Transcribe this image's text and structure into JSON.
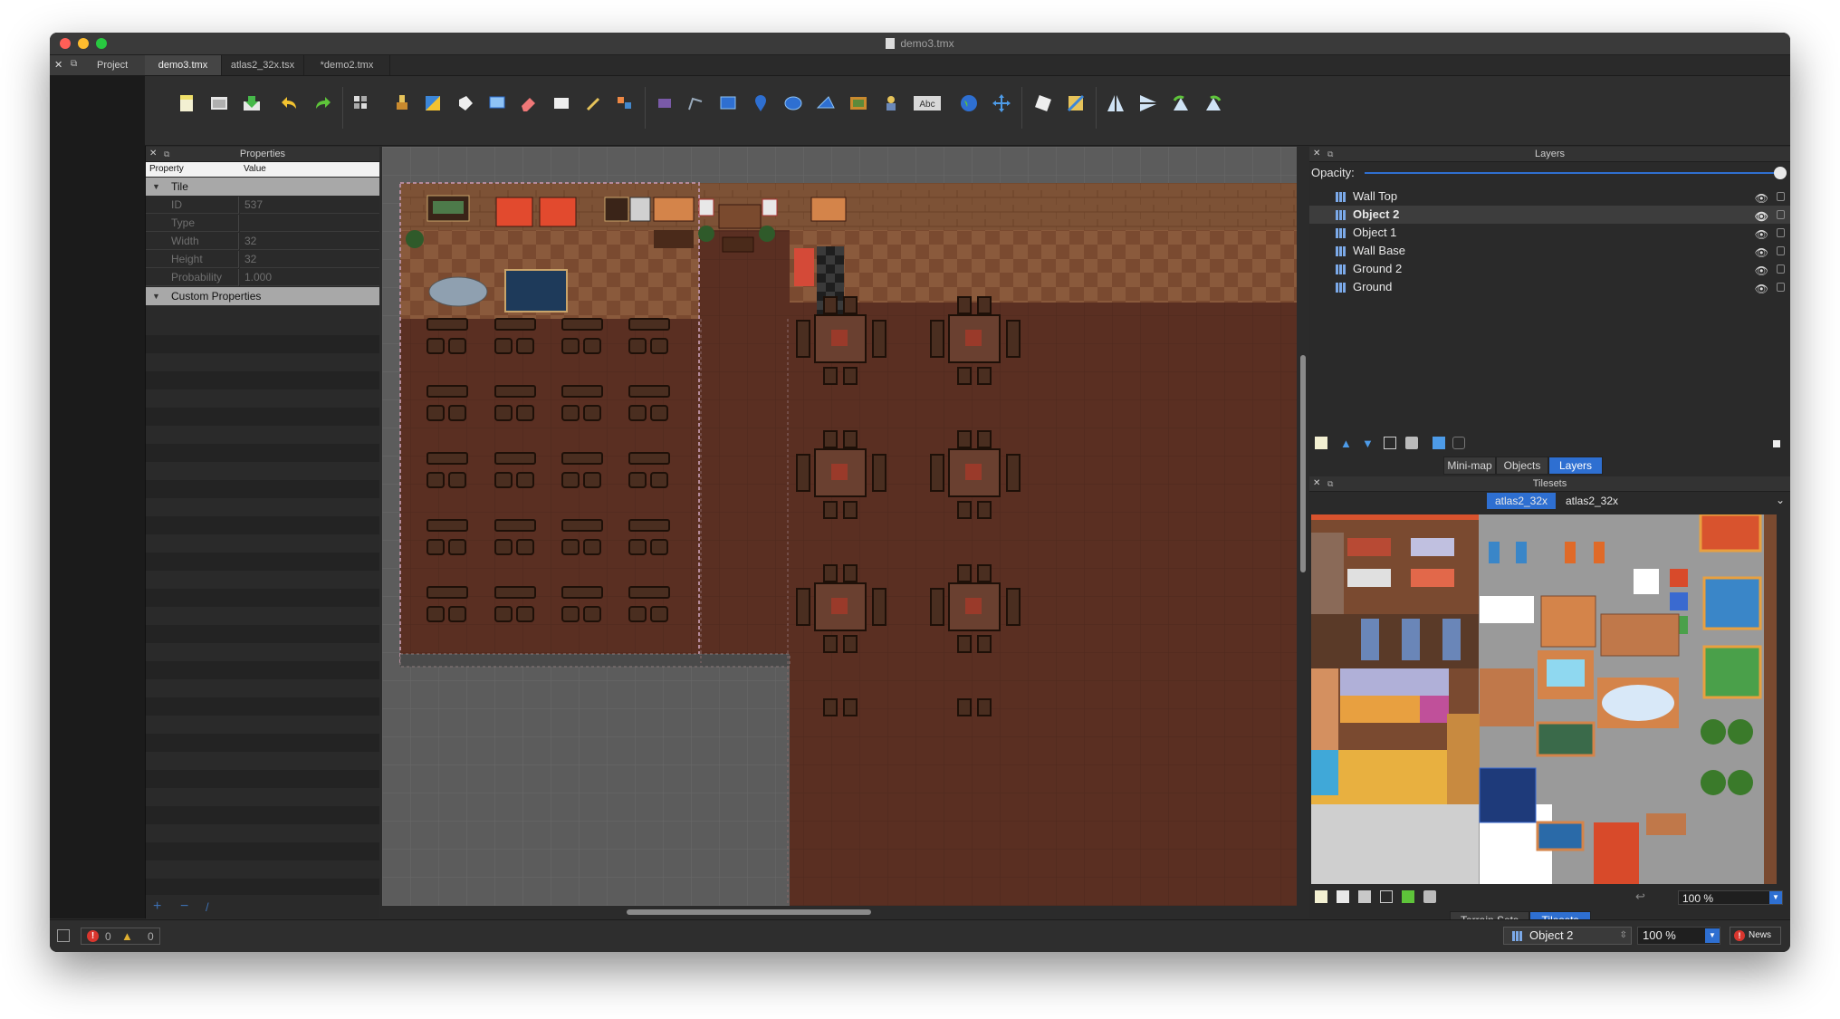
{
  "window": {
    "title": "demo3.tmx"
  },
  "tabs": {
    "project": "Project",
    "documents": [
      "demo3.tmx",
      "atlas2_32x.tsx",
      "*demo2.tmx"
    ],
    "active_index": 0
  },
  "toolbar": {
    "icons": [
      "new-file-icon",
      "open-file-icon",
      "save-icon",
      "undo-icon",
      "redo-icon",
      "tile-stamp-icon",
      "terrain-brush-icon",
      "bucket-fill-icon",
      "shape-fill-icon",
      "rectangle-select-icon",
      "eraser-icon",
      "tile-select-icon",
      "magic-wand-icon",
      "same-tile-select-icon",
      "object-select-icon",
      "edit-polygon-icon",
      "insert-rectangle-icon",
      "insert-point-icon",
      "insert-ellipse-icon",
      "insert-polygon-icon",
      "insert-tile-icon",
      "insert-template-icon",
      "insert-text-icon",
      "world-tool-icon",
      "move-icon",
      "random-mode-icon",
      "wang-fill-icon",
      "flip-horizontal-icon",
      "flip-vertical-icon",
      "rotate-left-icon",
      "rotate-right-icon"
    ]
  },
  "properties": {
    "title": "Properties",
    "col_property": "Property",
    "col_value": "Value",
    "group_tile": "Tile",
    "rows": [
      {
        "key": "ID",
        "value": "537"
      },
      {
        "key": "Type",
        "value": ""
      },
      {
        "key": "Width",
        "value": "32"
      },
      {
        "key": "Height",
        "value": "32"
      },
      {
        "key": "Probability",
        "value": "1.000"
      }
    ],
    "group_custom": "Custom Properties"
  },
  "layers": {
    "title": "Layers",
    "opacity_label": "Opacity:",
    "items": [
      {
        "name": "Wall Top"
      },
      {
        "name": "Object 2"
      },
      {
        "name": "Object 1"
      },
      {
        "name": "Wall Base"
      },
      {
        "name": "Ground 2"
      },
      {
        "name": "Ground"
      }
    ],
    "selected": "Object 2",
    "bottom_tabs": [
      "Mini-map",
      "Objects",
      "Layers"
    ],
    "active_tab": "Layers"
  },
  "tilesets": {
    "title": "Tilesets",
    "tabs": [
      "atlas2_32x",
      "atlas2_32x"
    ],
    "zoom": "100 %",
    "bottom_tabs": [
      "Terrain Sets",
      "Tilesets"
    ],
    "active_tab": "Tilesets"
  },
  "status": {
    "errors": "0",
    "warnings": "0",
    "current_layer": "Object 2",
    "zoom": "100 %",
    "news": "News"
  },
  "colors": {
    "accent": "#2e6fd1",
    "floor": "#5a2f22",
    "wall": "#8a5a3c",
    "background": "#2b2b2b"
  }
}
